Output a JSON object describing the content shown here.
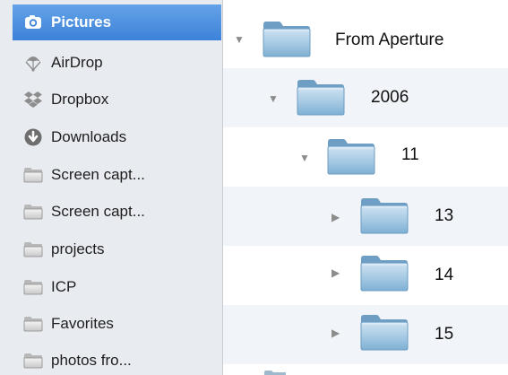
{
  "sidebar": {
    "items": [
      {
        "label": "Pictures",
        "icon": "camera-icon",
        "selected": true
      },
      {
        "label": "AirDrop",
        "icon": "airdrop-icon"
      },
      {
        "label": "Dropbox",
        "icon": "dropbox-icon"
      },
      {
        "label": "Downloads",
        "icon": "download-icon"
      },
      {
        "label": "Screen capt...",
        "icon": "folder-icon"
      },
      {
        "label": "Screen capt...",
        "icon": "folder-icon"
      },
      {
        "label": "projects",
        "icon": "folder-icon"
      },
      {
        "label": "ICP",
        "icon": "folder-icon"
      },
      {
        "label": "Favorites",
        "icon": "folder-icon"
      },
      {
        "label": "photos fro...",
        "icon": "folder-icon"
      }
    ]
  },
  "tree": {
    "rows": [
      {
        "label": "From Aperture",
        "expanded": true
      },
      {
        "label": "2006",
        "expanded": true
      },
      {
        "label": "11",
        "expanded": true
      },
      {
        "label": "13",
        "expanded": false
      },
      {
        "label": "14",
        "expanded": false
      },
      {
        "label": "15",
        "expanded": false
      }
    ]
  },
  "colors": {
    "selection": "#3d82d9",
    "sidebar_bg": "#e8ebf0",
    "row_alt": "#f1f4f8",
    "folder_blue": "#9cc3df"
  }
}
